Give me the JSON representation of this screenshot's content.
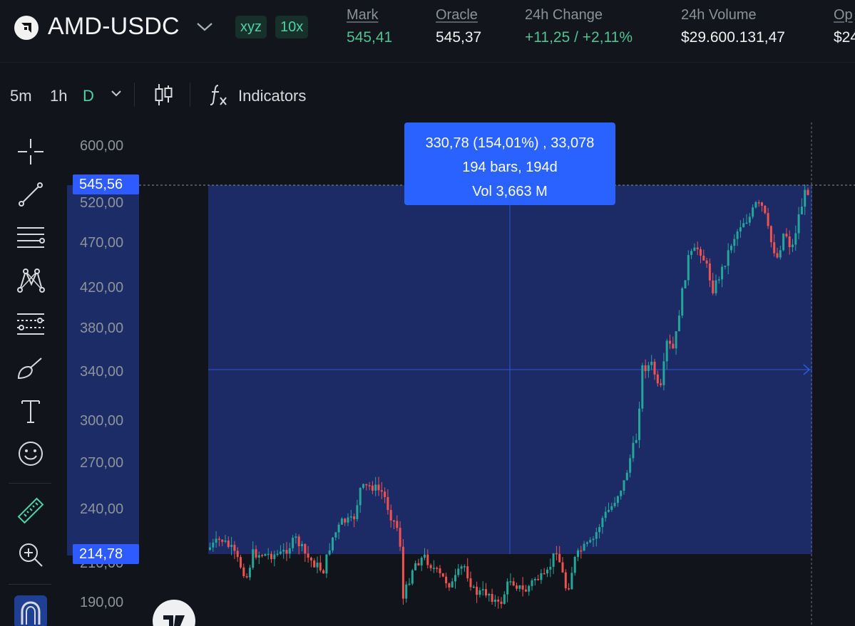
{
  "header": {
    "pair": "AMD-USDC",
    "badges": [
      "xyz",
      "10x"
    ],
    "stats": [
      {
        "label": "Mark",
        "value": "545,41"
      },
      {
        "label": "Oracle",
        "value": "545,37"
      },
      {
        "label": "24h Change",
        "value": "+11,25 / +2,11%"
      },
      {
        "label": "24h Volume",
        "value": "$29.600.131,47"
      },
      {
        "label": "Op",
        "value": "$24"
      }
    ]
  },
  "toolbar": {
    "timeframes": [
      "5m",
      "1h",
      "D"
    ],
    "active_timeframe": "D",
    "indicators_label": "Indicators"
  },
  "tools": [
    "crosshair-icon",
    "trend-line-icon",
    "horizontal-lines-icon",
    "pattern-icon",
    "fib-icon",
    "brush-icon",
    "text-icon",
    "emoji-icon",
    "ruler-icon",
    "zoom-in-icon",
    "magnet-icon"
  ],
  "chart": {
    "y_axis_labels": [
      "600,00",
      "520,00",
      "470,00",
      "420,00",
      "380,00",
      "340,00",
      "300,00",
      "270,00",
      "240,00",
      "210,00",
      "190,00"
    ],
    "range_high_label": "545,56",
    "range_low_label": "214,78",
    "tooltip": {
      "line1": "330,78 (154,01%) , 33,078",
      "line2": "194 bars, 194d",
      "line3": "Vol 3,663 M"
    },
    "colors": {
      "up": "#26a69a",
      "down": "#ef5350",
      "selection": "#1e2f73",
      "accent": "#2962ff"
    }
  }
}
